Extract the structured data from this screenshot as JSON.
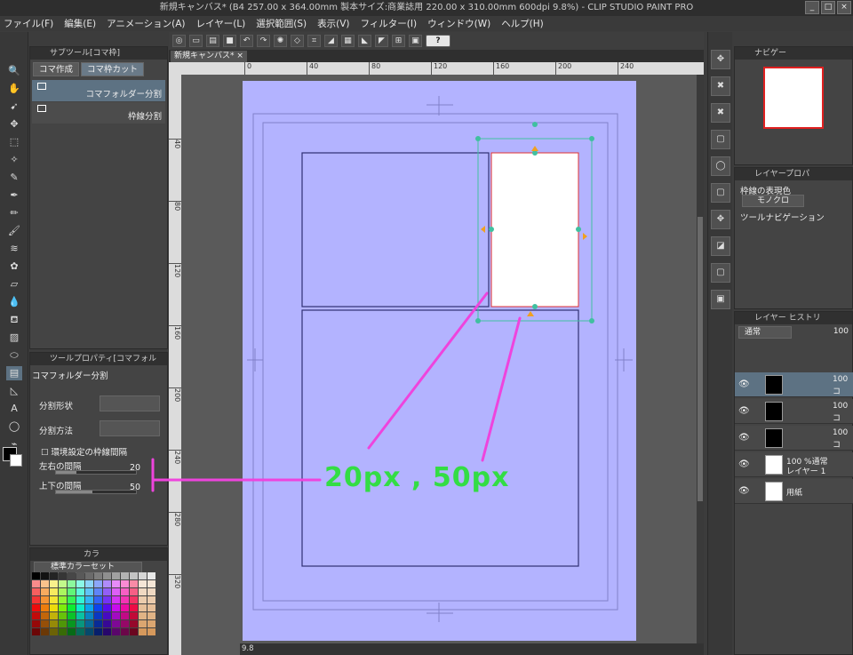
{
  "window": {
    "title": "新規キャンバス* (B4 257.00 x 364.00mm 製本サイズ:商業誌用 220.00 x 310.00mm 600dpi 9.8%) - CLIP STUDIO PAINT PRO",
    "min": "_",
    "max": "□",
    "close": "×"
  },
  "menu": [
    "ファイル(F)",
    "編集(E)",
    "アニメーション(A)",
    "レイヤー(L)",
    "選択範囲(S)",
    "表示(V)",
    "フィルター(I)",
    "ウィンドウ(W)",
    "ヘルプ(H)"
  ],
  "toolbar": {
    "help": "?"
  },
  "subtool": {
    "title": "サブツール[コマ枠]",
    "tabs": [
      "コマ作成",
      "コマ枠カット"
    ],
    "items": [
      "コマフォルダー分割",
      "枠線分割"
    ]
  },
  "toolprop": {
    "title": "ツールプロパティ[コマフォル",
    "name": "コマフォルダー分割",
    "shape_label": "分割形状",
    "method_label": "分割方法",
    "env_checkbox": "環境設定の枠線間隔",
    "lr_label": "左右の間隔",
    "lr_value": "20",
    "lr_fraction": 0.25,
    "ud_label": "上下の間隔",
    "ud_value": "50",
    "ud_fraction": 0.45
  },
  "color_panel": {
    "tab": "カラ",
    "set": "標準カラーセット"
  },
  "document": {
    "tab": "新規キャンバス*",
    "close": "×",
    "zoom": "9.8"
  },
  "ruler_top": [
    "0",
    "40",
    "80",
    "120",
    "160",
    "200",
    "240"
  ],
  "ruler_left": [
    "40",
    "80",
    "120",
    "160",
    "200",
    "240",
    "280",
    "320"
  ],
  "annotation": {
    "text": "20px , 50px",
    "color": "#33dd44",
    "line_color": "#ee44dd"
  },
  "navigator": {
    "title": "ナビゲー"
  },
  "layerprop": {
    "title": "レイヤープロパ",
    "border_color_label": "枠線の表現色",
    "mono": "モノクロ",
    "tool_nav": "ツールナビゲーション"
  },
  "layers": {
    "title": "レイヤー",
    "history_tab": "ヒストリ",
    "blend": "通常",
    "opacity": "100",
    "rows": [
      {
        "name": "100",
        "sub": "コ"
      },
      {
        "name": "100",
        "sub": "コ"
      },
      {
        "name": "100",
        "sub": "コ"
      },
      {
        "name": "100 %通常",
        "sub": "レイヤー 1"
      },
      {
        "name": "用紙",
        "sub": ""
      }
    ]
  },
  "colors": {
    "page": "#b3b3ff",
    "panel_line": "#2f2f72",
    "selected_frame": "#ffffff"
  }
}
